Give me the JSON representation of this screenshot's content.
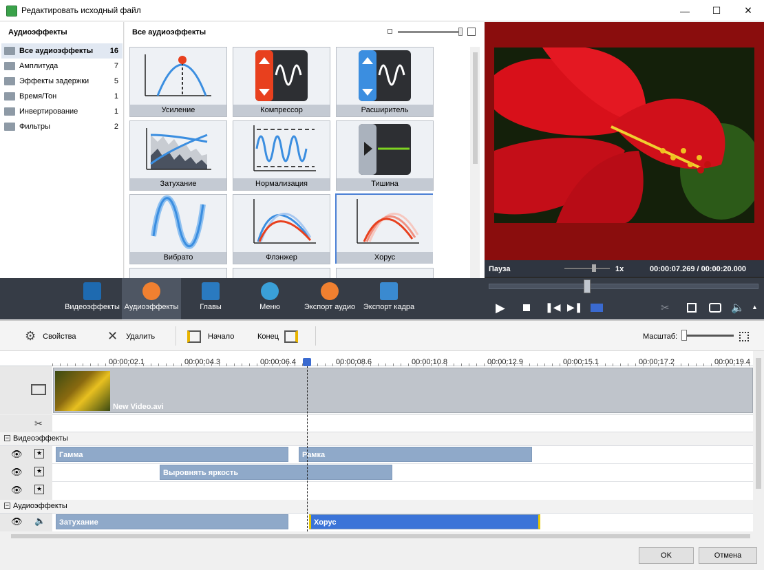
{
  "window": {
    "title": "Редактировать исходный файл"
  },
  "categories": {
    "header": "Аудиоэффекты",
    "items": [
      {
        "label": "Все аудиоэффекты",
        "count": "16"
      },
      {
        "label": "Амплитуда",
        "count": "7"
      },
      {
        "label": "Эффекты задержки",
        "count": "5"
      },
      {
        "label": "Время/Тон",
        "count": "1"
      },
      {
        "label": "Инвертирование",
        "count": "1"
      },
      {
        "label": "Фильтры",
        "count": "2"
      }
    ]
  },
  "effects": {
    "header": "Все аудиоэффекты",
    "tiles": [
      "Усиление",
      "Компрессор",
      "Расширитель",
      "Затухание",
      "Нормализация",
      "Тишина",
      "Вибрато",
      "Флэнжер",
      "Хорус"
    ],
    "selected": "Хорус"
  },
  "player": {
    "status": "Пауза",
    "speed": "1x",
    "time": "00:00:07.269 / 00:00:20.000"
  },
  "tabs": [
    "Видеоэффекты",
    "Аудиоэффекты",
    "Главы",
    "Меню",
    "Экспорт аудио",
    "Экспорт кадра"
  ],
  "toolbar": {
    "properties": "Свойства",
    "delete": "Удалить",
    "start": "Начало",
    "end": "Конец",
    "zoom": "Масштаб:"
  },
  "ruler": [
    "00:00:02.1",
    "00:00:04.3",
    "00:00:06.4",
    "00:00:08.6",
    "00:00:10.8",
    "00:00:12.9",
    "00:00:15.1",
    "00:00:17.2",
    "00:00:19.4"
  ],
  "timeline": {
    "video_clip": "New Video.avi",
    "video_section": "Видеоэффекты",
    "audio_section": "Аудиоэффекты",
    "video_effects": [
      "Гамма",
      "Рамка",
      "Выровнять яркость"
    ],
    "audio_effects": [
      "Затухание",
      "Хорус"
    ]
  },
  "buttons": {
    "ok": "OK",
    "cancel": "Отмена"
  },
  "colors": {
    "accent": "#3b74d8",
    "clip": "#8fa9c9",
    "selected_clip": "#3b74d8",
    "dark": "#363c46"
  }
}
